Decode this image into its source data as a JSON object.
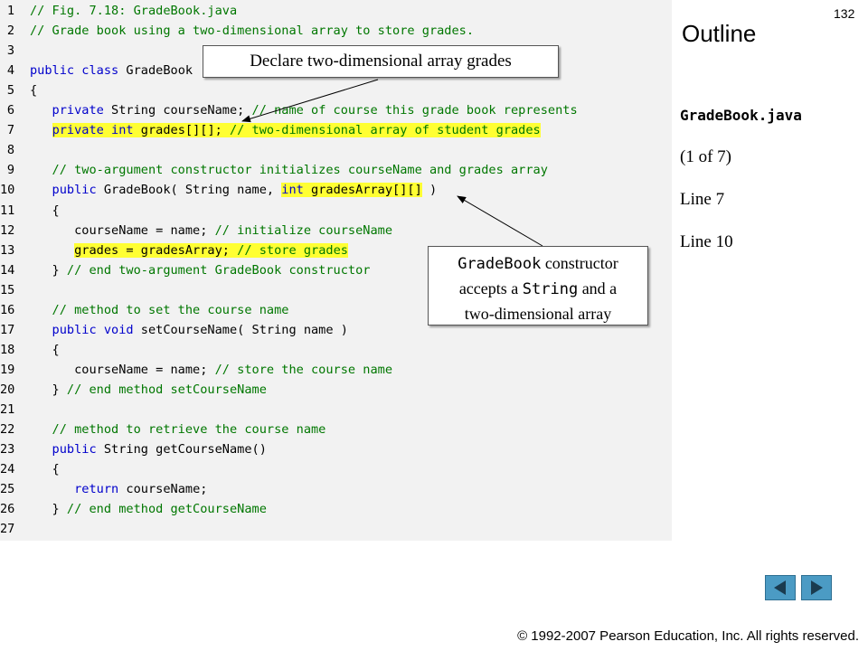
{
  "page_number": "132",
  "outline_title": "Outline",
  "sidebar": {
    "file": "GradeBook.java",
    "pages": "(1 of 7)",
    "line_a": "Line 7",
    "line_b": "Line 10"
  },
  "callouts": {
    "one": "Declare two-dimensional array grades",
    "two_code1": "GradeBook",
    "two_text1": " constructor",
    "two_text2": "accepts a ",
    "two_code2": "String",
    "two_text3": " and a",
    "two_text4": "two-dimensional array"
  },
  "copyright": "© 1992-2007 Pearson Education, Inc.  All rights reserved.",
  "code_lines": [
    {
      "n": "1",
      "parts": [
        {
          "t": "// Fig. 7.18: GradeBook.java",
          "c": "cm"
        }
      ]
    },
    {
      "n": "2",
      "parts": [
        {
          "t": "// Grade book using a two-dimensional array to store grades.",
          "c": "cm"
        }
      ]
    },
    {
      "n": "3",
      "parts": []
    },
    {
      "n": "4",
      "parts": [
        {
          "t": "public class ",
          "c": "kw"
        },
        {
          "t": "GradeBook",
          "c": "tx"
        }
      ]
    },
    {
      "n": "5",
      "parts": [
        {
          "t": "{",
          "c": "tx"
        }
      ]
    },
    {
      "n": "6",
      "parts": [
        {
          "t": "   private ",
          "c": "kw"
        },
        {
          "t": "String courseName; ",
          "c": "tx"
        },
        {
          "t": "// name of course this grade book represents",
          "c": "cm"
        }
      ]
    },
    {
      "n": "7",
      "parts": [
        {
          "t": "   ",
          "c": "tx"
        },
        {
          "t": "private int ",
          "c": "kw",
          "h": true
        },
        {
          "t": "grades[][]; ",
          "c": "tx",
          "h": true
        },
        {
          "t": "// two-dimensional array of student grades",
          "c": "cm",
          "h": true
        }
      ]
    },
    {
      "n": "8",
      "parts": []
    },
    {
      "n": "9",
      "parts": [
        {
          "t": "   // two-argument constructor initializes courseName and grades array",
          "c": "cm"
        }
      ]
    },
    {
      "n": "10",
      "parts": [
        {
          "t": "   public ",
          "c": "kw"
        },
        {
          "t": "GradeBook( String name, ",
          "c": "tx"
        },
        {
          "t": "int ",
          "c": "kw",
          "h": true
        },
        {
          "t": "gradesArray[][]",
          "c": "tx",
          "h": true
        },
        {
          "t": " )",
          "c": "tx"
        }
      ]
    },
    {
      "n": "11",
      "parts": [
        {
          "t": "   {",
          "c": "tx"
        }
      ]
    },
    {
      "n": "12",
      "parts": [
        {
          "t": "      courseName = name; ",
          "c": "tx"
        },
        {
          "t": "// initialize courseName",
          "c": "cm"
        }
      ]
    },
    {
      "n": "13",
      "parts": [
        {
          "t": "      ",
          "c": "tx"
        },
        {
          "t": "grades = gradesArray; ",
          "c": "tx",
          "h": true
        },
        {
          "t": "// store grades",
          "c": "cm",
          "h": true
        }
      ]
    },
    {
      "n": "14",
      "parts": [
        {
          "t": "   } ",
          "c": "tx"
        },
        {
          "t": "// end two-argument GradeBook constructor",
          "c": "cm"
        }
      ]
    },
    {
      "n": "15",
      "parts": []
    },
    {
      "n": "16",
      "parts": [
        {
          "t": "   // method to set the course name",
          "c": "cm"
        }
      ]
    },
    {
      "n": "17",
      "parts": [
        {
          "t": "   public void ",
          "c": "kw"
        },
        {
          "t": "setCourseName( String name )",
          "c": "tx"
        }
      ]
    },
    {
      "n": "18",
      "parts": [
        {
          "t": "   {",
          "c": "tx"
        }
      ]
    },
    {
      "n": "19",
      "parts": [
        {
          "t": "      courseName = name; ",
          "c": "tx"
        },
        {
          "t": "// store the course name",
          "c": "cm"
        }
      ]
    },
    {
      "n": "20",
      "parts": [
        {
          "t": "   } ",
          "c": "tx"
        },
        {
          "t": "// end method setCourseName",
          "c": "cm"
        }
      ]
    },
    {
      "n": "21",
      "parts": []
    },
    {
      "n": "22",
      "parts": [
        {
          "t": "   // method to retrieve the course name",
          "c": "cm"
        }
      ]
    },
    {
      "n": "23",
      "parts": [
        {
          "t": "   public ",
          "c": "kw"
        },
        {
          "t": "String getCourseName()",
          "c": "tx"
        }
      ]
    },
    {
      "n": "24",
      "parts": [
        {
          "t": "   {",
          "c": "tx"
        }
      ]
    },
    {
      "n": "25",
      "parts": [
        {
          "t": "      return ",
          "c": "kw"
        },
        {
          "t": "courseName;",
          "c": "tx"
        }
      ]
    },
    {
      "n": "26",
      "parts": [
        {
          "t": "   } ",
          "c": "tx"
        },
        {
          "t": "// end method getCourseName",
          "c": "cm"
        }
      ]
    },
    {
      "n": "27",
      "parts": []
    }
  ],
  "colors": {
    "keyword": "#0000cc",
    "comment": "#007700",
    "highlight": "#ffff33",
    "nav_button": "#4b9bc4"
  },
  "icons": {
    "prev": "triangle-left-icon",
    "next": "triangle-right-icon"
  }
}
